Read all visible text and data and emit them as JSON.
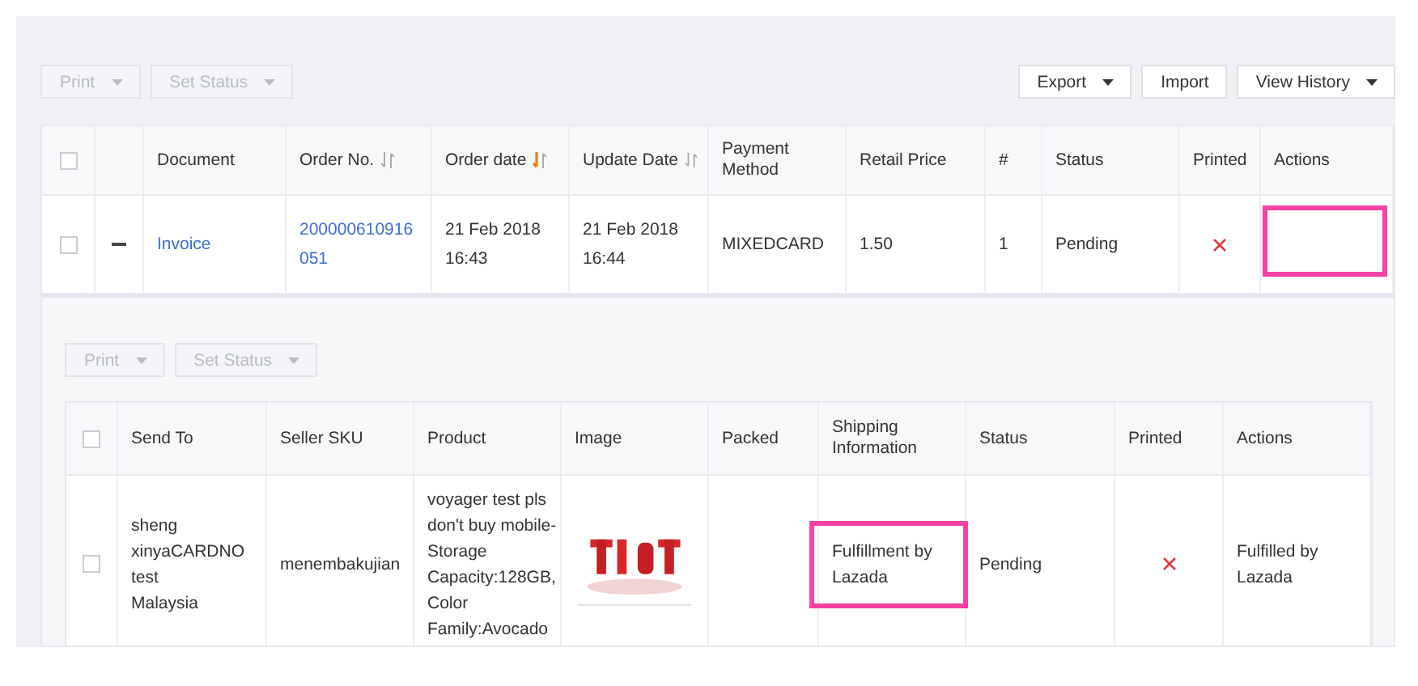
{
  "toolbar": {
    "left": [
      {
        "label": "Print",
        "dropdown": true,
        "disabled": true
      },
      {
        "label": "Set Status",
        "dropdown": true,
        "disabled": true
      }
    ],
    "right": [
      {
        "label": "Export",
        "dropdown": true,
        "disabled": false
      },
      {
        "label": "Import",
        "dropdown": false,
        "disabled": false
      },
      {
        "label": "View History",
        "dropdown": true,
        "disabled": false
      }
    ]
  },
  "orders_table": {
    "all_checked": false,
    "columns": [
      {
        "label": "Document"
      },
      {
        "label": "Order No.",
        "sort_active": false
      },
      {
        "label": "Order date",
        "sort_active": true
      },
      {
        "label": "Update Date",
        "sort_active": false
      },
      {
        "label": "Payment\nMethod"
      },
      {
        "label": "Retail Price"
      },
      {
        "label": "#"
      },
      {
        "label": "Status"
      },
      {
        "label": "Printed"
      },
      {
        "label": "Actions"
      }
    ],
    "rows": [
      {
        "checked": false,
        "expanded": true,
        "cells": [
          {
            "kind": "link",
            "text": "Invoice",
            "highlighted": false
          },
          {
            "kind": "link",
            "text": "200000610916051",
            "highlighted": false
          },
          {
            "kind": "text",
            "text": "21 Feb 2018\n16:43",
            "highlighted": false
          },
          {
            "kind": "text",
            "text": "21 Feb 2018\n16:44",
            "highlighted": false
          },
          {
            "kind": "text",
            "text": "MIXEDCARD",
            "highlighted": false
          },
          {
            "kind": "text",
            "text": "1.50",
            "highlighted": false
          },
          {
            "kind": "text",
            "text": "1",
            "highlighted": false
          },
          {
            "kind": "text",
            "text": "Pending",
            "highlighted": false
          },
          {
            "kind": "printed",
            "printed": false,
            "highlighted": false
          },
          {
            "kind": "empty",
            "highlighted": true
          }
        ]
      }
    ]
  },
  "sub_toolbar": [
    {
      "label": "Print",
      "dropdown": true,
      "disabled": true
    },
    {
      "label": "Set Status",
      "dropdown": true,
      "disabled": true
    }
  ],
  "items_table": {
    "all_checked": false,
    "columns": [
      {
        "label": "Send To"
      },
      {
        "label": "Seller SKU"
      },
      {
        "label": "Product"
      },
      {
        "label": "Image"
      },
      {
        "label": "Packed"
      },
      {
        "label": "Shipping\nInformation"
      },
      {
        "label": "Status"
      },
      {
        "label": "Printed"
      },
      {
        "label": "Actions"
      }
    ],
    "rows": [
      {
        "checked": false,
        "cells": [
          {
            "kind": "text",
            "text": "sheng\nxinyaCARDNO\ntest\nMalaysia",
            "highlighted": false
          },
          {
            "kind": "text",
            "text": "menembakujian",
            "highlighted": false
          },
          {
            "kind": "text",
            "text": "voyager test pls\ndon't buy mobile-\nStorage\nCapacity:128GB,\nColor\nFamily:Avocado",
            "highlighted": false
          },
          {
            "kind": "picture",
            "highlighted": false
          },
          {
            "kind": "empty",
            "highlighted": false
          },
          {
            "kind": "text",
            "text": "Fulfillment by\nLazada",
            "highlighted": true
          },
          {
            "kind": "text",
            "text": "Pending",
            "highlighted": false
          },
          {
            "kind": "printed",
            "printed": false,
            "highlighted": false
          },
          {
            "kind": "text",
            "text": "Fulfilled by\nLazada",
            "highlighted": false
          }
        ]
      }
    ]
  }
}
